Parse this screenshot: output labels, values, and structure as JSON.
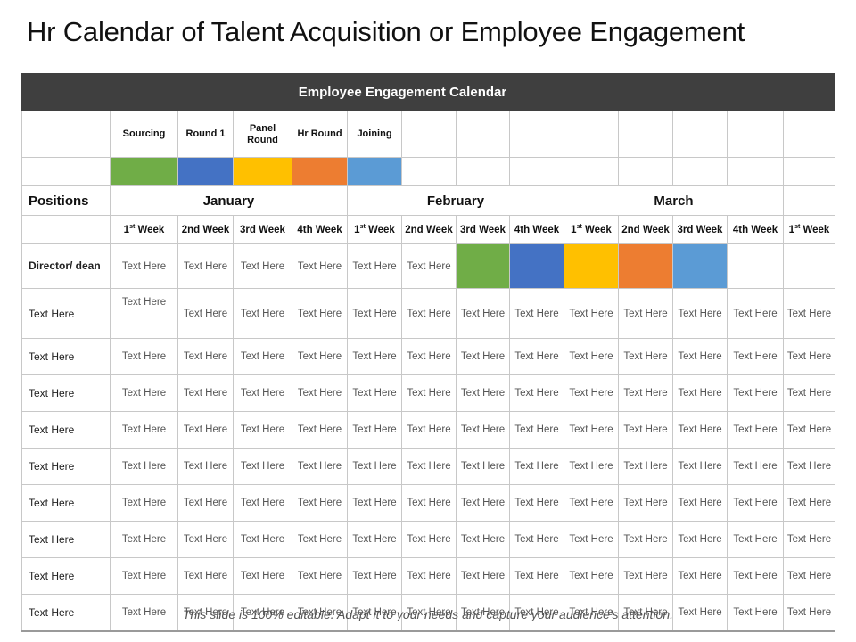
{
  "title": "Hr Calendar of Talent Acquisition or Employee Engagement",
  "calendar": {
    "heading": "Employee Engagement Calendar",
    "legend": [
      {
        "label": "Sourcing",
        "color": "#70AD47"
      },
      {
        "label": "Round 1",
        "color": "#4472C4"
      },
      {
        "label": "Panel Round",
        "color": "#FFC000"
      },
      {
        "label": "Hr Round",
        "color": "#ED7D31"
      },
      {
        "label": "Joining",
        "color": "#5B9BD5"
      }
    ],
    "positions_label": "Positions",
    "months": [
      "January",
      "February",
      "March"
    ],
    "weeks": [
      {
        "num": "1",
        "sup": "st",
        "rest": " Week"
      },
      {
        "num": "2nd Week",
        "sup": "",
        "rest": ""
      },
      {
        "num": "3rd Week",
        "sup": "",
        "rest": ""
      },
      {
        "num": "4th Week",
        "sup": "",
        "rest": ""
      },
      {
        "num": "1",
        "sup": "st",
        "rest": " Week"
      },
      {
        "num": "2nd Week",
        "sup": "",
        "rest": ""
      },
      {
        "num": "3rd Week",
        "sup": "",
        "rest": ""
      },
      {
        "num": "4th Week",
        "sup": "",
        "rest": ""
      },
      {
        "num": "1",
        "sup": "st",
        "rest": " Week"
      },
      {
        "num": "2nd Week",
        "sup": "",
        "rest": ""
      },
      {
        "num": "3rd Week",
        "sup": "",
        "rest": ""
      },
      {
        "num": "4th Week",
        "sup": "",
        "rest": ""
      },
      {
        "num": "1",
        "sup": "st",
        "rest": " Week"
      }
    ],
    "director_row": {
      "label": "Director/ dean",
      "cells": [
        "Text Here",
        "Text Here",
        "Text Here",
        "Text Here",
        "Text Here",
        "Text Here"
      ],
      "color_blocks": [
        "#70AD47",
        "#4472C4",
        "#FFC000",
        "#ED7D31",
        "#5B9BD5"
      ]
    },
    "rows": [
      {
        "label": "Text Here",
        "cells": [
          "Text Here",
          "Text Here",
          "Text Here",
          "Text Here",
          "Text Here",
          "Text Here",
          "Text Here",
          "Text Here",
          "Text Here",
          "Text Here",
          "Text Here",
          "Text Here",
          "Text Here"
        ]
      },
      {
        "label": "Text Here",
        "cells": [
          "Text Here",
          "Text Here",
          "Text Here",
          "Text Here",
          "Text Here",
          "Text Here",
          "Text Here",
          "Text Here",
          "Text Here",
          "Text Here",
          "Text Here",
          "Text Here",
          "Text Here"
        ]
      },
      {
        "label": "Text Here",
        "cells": [
          "Text Here",
          "Text Here",
          "Text Here",
          "Text Here",
          "Text Here",
          "Text Here",
          "Text Here",
          "Text Here",
          "Text Here",
          "Text Here",
          "Text Here",
          "Text Here",
          "Text Here"
        ]
      },
      {
        "label": "Text Here",
        "cells": [
          "Text Here",
          "Text Here",
          "Text Here",
          "Text Here",
          "Text Here",
          "Text Here",
          "Text Here",
          "Text Here",
          "Text Here",
          "Text Here",
          "Text Here",
          "Text Here",
          "Text Here"
        ]
      },
      {
        "label": "Text Here",
        "cells": [
          "Text Here",
          "Text Here",
          "Text Here",
          "Text Here",
          "Text Here",
          "Text Here",
          "Text Here",
          "Text Here",
          "Text Here",
          "Text Here",
          "Text Here",
          "Text Here",
          "Text Here"
        ]
      },
      {
        "label": "Text Here",
        "cells": [
          "Text Here",
          "Text Here",
          "Text Here",
          "Text Here",
          "Text Here",
          "Text Here",
          "Text Here",
          "Text Here",
          "Text Here",
          "Text Here",
          "Text Here",
          "Text Here",
          "Text Here"
        ]
      },
      {
        "label": "Text Here",
        "cells": [
          "Text Here",
          "Text Here",
          "Text Here",
          "Text Here",
          "Text Here",
          "Text Here",
          "Text Here",
          "Text Here",
          "Text Here",
          "Text Here",
          "Text Here",
          "Text Here",
          "Text Here"
        ]
      },
      {
        "label": "Text Here",
        "cells": [
          "Text Here",
          "Text Here",
          "Text Here",
          "Text Here",
          "Text Here",
          "Text Here",
          "Text Here",
          "Text Here",
          "Text Here",
          "Text Here",
          "Text Here",
          "Text Here",
          "Text Here"
        ]
      },
      {
        "label": "Text Here",
        "cells": [
          "Text Here",
          "Text Here",
          "Text Here",
          "Text Here",
          "Text Here",
          "Text Here",
          "Text Here",
          "Text Here",
          "Text Here",
          "Text Here",
          "Text Here",
          "Text Here",
          "Text Here"
        ]
      }
    ]
  },
  "footer": "This slide is 100% editable. Adapt it to your needs and capture your audience's attention."
}
